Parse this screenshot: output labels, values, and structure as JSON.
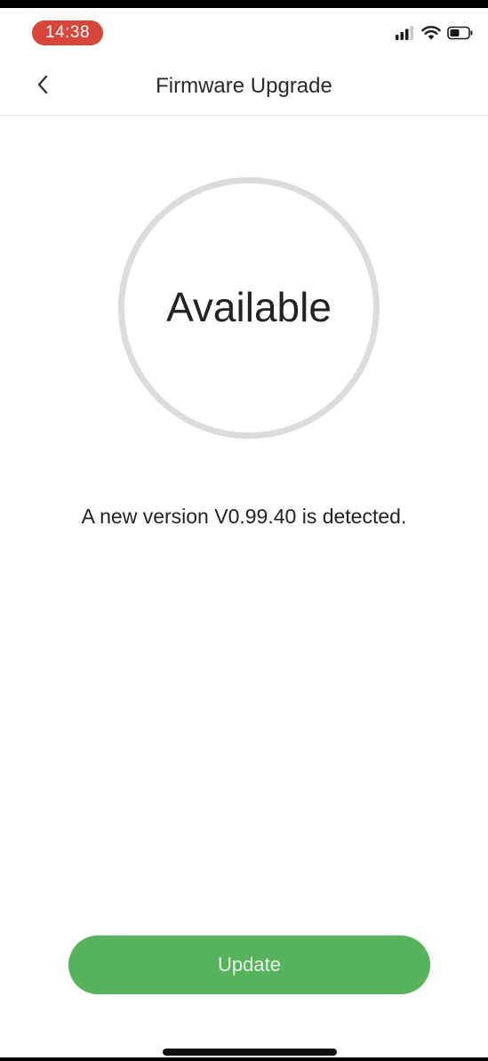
{
  "status_bar": {
    "time": "14:38",
    "time_pill_color": "#d7463a",
    "icons": [
      "cellular-signal-icon",
      "wifi-icon",
      "battery-icon"
    ]
  },
  "nav": {
    "back_icon": "chevron-left-icon",
    "title": "Firmware Upgrade"
  },
  "status_ring": {
    "label": "Available"
  },
  "message": "A new version V0.99.40 is detected.",
  "update_button": {
    "label": "Update",
    "color": "#57b25c"
  }
}
